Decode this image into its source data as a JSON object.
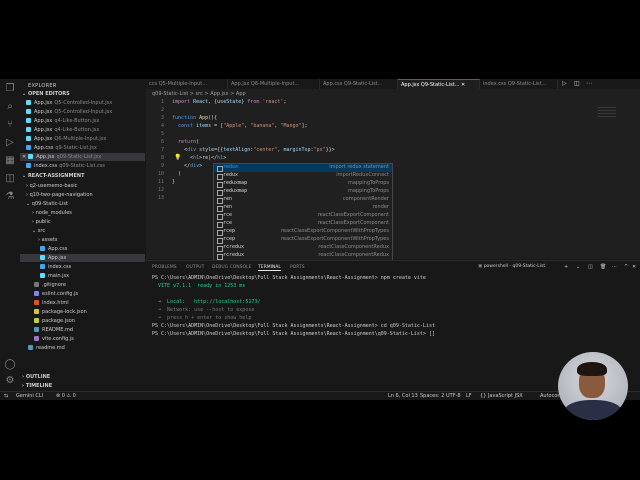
{
  "tabs": [
    {
      "label": "Q5-Multiple-Input...",
      "dim": "ccs"
    },
    {
      "label": "App.jsx",
      "dim": "Q6-Multiple-Input..."
    },
    {
      "label": "App.css",
      "dim": "Q9-Static-List..."
    },
    {
      "label": "App.jsx",
      "dim": "Q9-Static-List..."
    },
    {
      "label": "index.css",
      "dim": "Q9-Static-List..."
    }
  ],
  "breadcrumb": "q09-Static-List > src > App.jsx > App",
  "sidebar": {
    "title": "EXPLORER",
    "open_editors_header": "OPEN EDITORS",
    "open_editors": [
      {
        "name": "App.jsx",
        "path": "Q5-Controlled-Input.jsx"
      },
      {
        "name": "App.jsx",
        "path": "Q5-Controlled-Input.jsx"
      },
      {
        "name": "App.jsx",
        "path": "q4-Like-Button.jsx"
      },
      {
        "name": "App.jsx",
        "path": "q4-Like-Button.jsx"
      },
      {
        "name": "App.jsx",
        "path": "Q6-Multiple-Input.jsx"
      },
      {
        "name": "App.css",
        "path": "q9-Static-List.jsx"
      },
      {
        "name": "App.jsx",
        "path": "q09-Static-List.jsx"
      },
      {
        "name": "index.css",
        "path": "q09-Static-List.css"
      }
    ],
    "project_header": "REACT-ASSIGNMENT",
    "tree": [
      "q2-usememo-basic",
      "q10-two-page-navigation",
      "q09-Static-List",
      "node_modules",
      "public",
      "src",
      "assets",
      "App.css",
      "App.jsx",
      "index.css",
      "main.jsx",
      ".gitignore",
      "eslint.config.js",
      "index.html",
      "package-lock.json",
      "package.json",
      "README.md",
      "vite.config.js",
      "readme.md"
    ],
    "outline": "OUTLINE",
    "timeline": "TIMELINE"
  },
  "editor": {
    "line_numbers": [
      "1",
      "2",
      "3",
      "4",
      "5",
      "6",
      "7",
      "8",
      "9",
      "10",
      "11",
      "12",
      "13"
    ]
  },
  "suggestions": [
    {
      "label": "redux",
      "detail": "import redux statement"
    },
    {
      "label": "redux",
      "detail": "importReduxConnect"
    },
    {
      "label": "reduxmap",
      "detail": "mappingToProps"
    },
    {
      "label": "reduxmap",
      "detail": "mappingToProps"
    },
    {
      "label": "ren",
      "detail": "componentRender"
    },
    {
      "label": "ren",
      "detail": "render"
    },
    {
      "label": "rce",
      "detail": "reactClassExportComponent"
    },
    {
      "label": "rce",
      "detail": "reactClassExportComponent"
    },
    {
      "label": "rcep",
      "detail": "reactClassExportComponentWithPropTypes"
    },
    {
      "label": "rcep",
      "detail": "reactClassExportComponentWithPropTypes"
    },
    {
      "label": "rcredux",
      "detail": "reactClassComponentRedux"
    },
    {
      "label": "rcredux",
      "detail": "reactClassComponentRedux"
    }
  ],
  "panel": {
    "tabs": [
      "PROBLEMS",
      "OUTPUT",
      "DEBUG CONSOLE",
      "TERMINAL",
      "PORTS"
    ],
    "shell": "powershell - q09-Static-List",
    "lines": [
      "PS C:\\Users\\ADMIN\\OneDrive\\Desktop\\Full Stack Assignments\\React-Assignment> npm create vite",
      "  VITE v7.1.1  ready in 1253 ms",
      "  ➜  Local:   http://localhost:5173/",
      "  ➜  Network: use --host to expose",
      "  ➜  press h + enter to show help",
      "PS C:\\Users\\ADMIN\\OneDrive\\Desktop\\Full Stack Assignments\\React-Assignment> cd q09-Static-List",
      "PS C:\\Users\\ADMIN\\OneDrive\\Desktop\\Full Stack Assignments\\React-Assignment\\q09-Static-List> []"
    ]
  },
  "status": {
    "left": [
      "Gemini CLI",
      "⊗ 0  ⚠ 0"
    ],
    "right": [
      "Ln 6, Col 13",
      "Spaces: 2",
      "UTF-8",
      "LF",
      "{} JavaScript JSX",
      "Autocomplete"
    ]
  }
}
